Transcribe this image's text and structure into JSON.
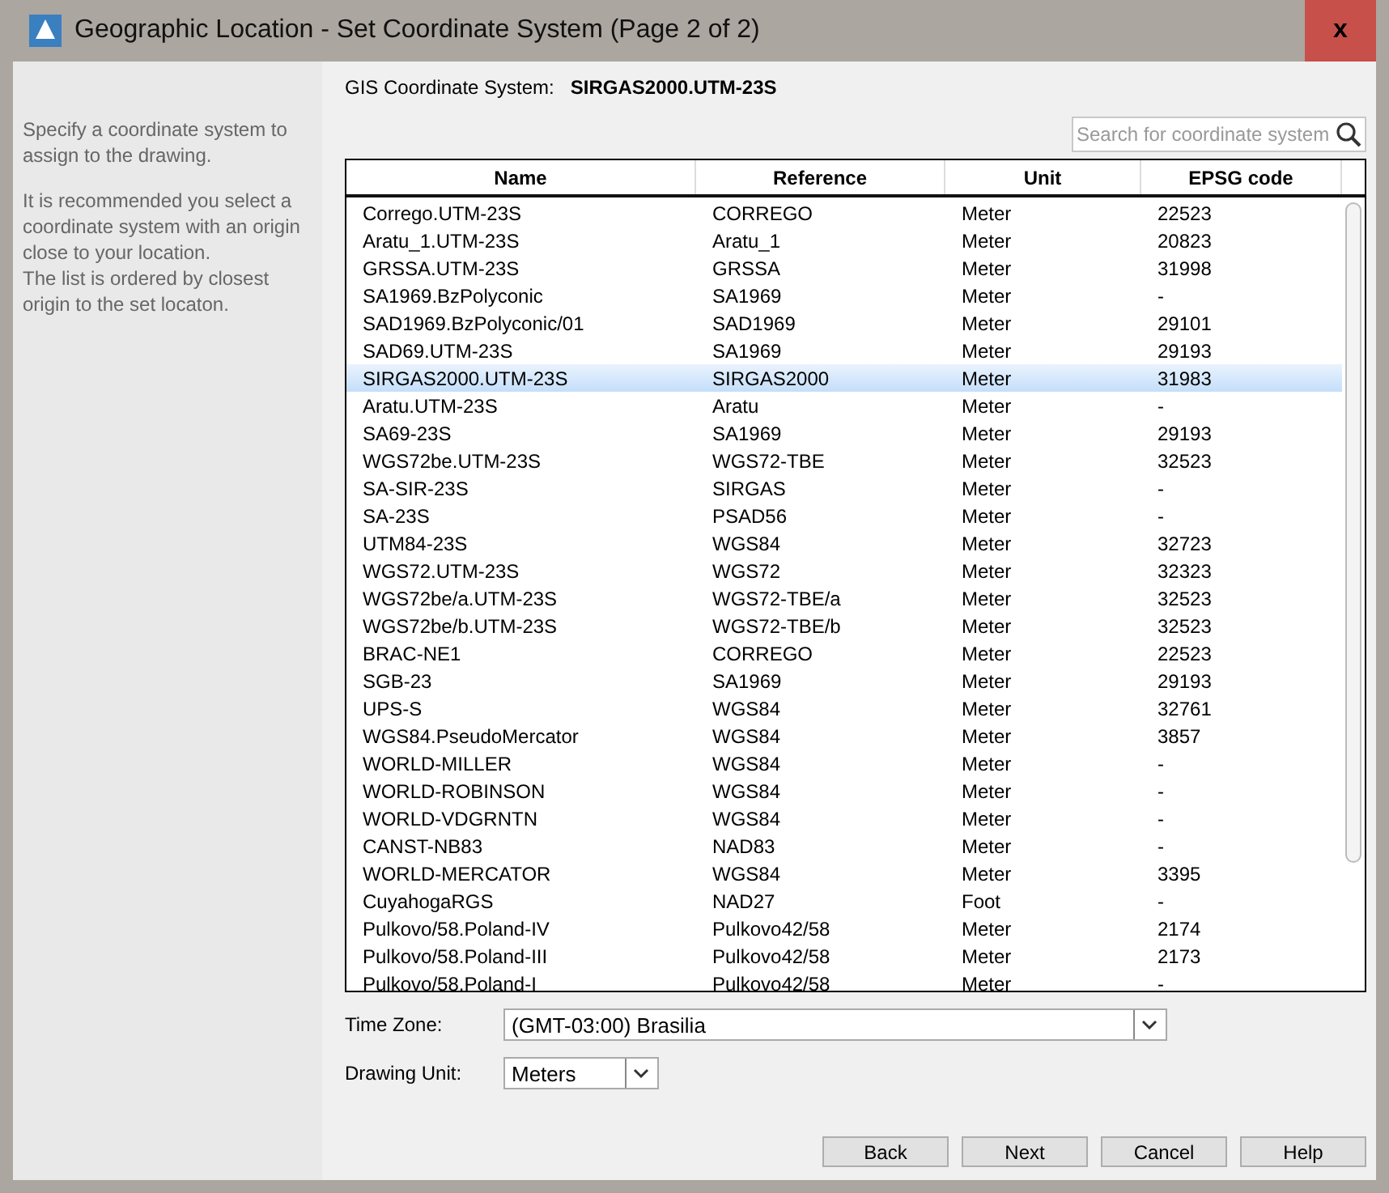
{
  "window": {
    "title": "Geographic Location - Set Coordinate System (Page 2 of 2)",
    "close": "x"
  },
  "sidebar": {
    "paragraphs": [
      "Specify a coordinate system to assign to the drawing.",
      "It is recommended you select a coordinate system with an origin close to your location.\nThe list is ordered by closest origin to the set locaton."
    ]
  },
  "gis": {
    "label": "GIS Coordinate System:",
    "value": "SIRGAS2000.UTM-23S"
  },
  "search": {
    "placeholder": "Search for coordinate system"
  },
  "table": {
    "columns": [
      "Name",
      "Reference",
      "Unit",
      "EPSG code"
    ],
    "rows": [
      {
        "cells": [
          "Corrego.UTM-23S",
          "CORREGO",
          "Meter",
          "22523"
        ],
        "selected": false
      },
      {
        "cells": [
          "Aratu_1.UTM-23S",
          "Aratu_1",
          "Meter",
          "20823"
        ],
        "selected": false
      },
      {
        "cells": [
          "GRSSA.UTM-23S",
          "GRSSA",
          "Meter",
          "31998"
        ],
        "selected": false
      },
      {
        "cells": [
          "SA1969.BzPolyconic",
          "SA1969",
          "Meter",
          "-"
        ],
        "selected": false
      },
      {
        "cells": [
          "SAD1969.BzPolyconic/01",
          "SAD1969",
          "Meter",
          "29101"
        ],
        "selected": false
      },
      {
        "cells": [
          "SAD69.UTM-23S",
          "SA1969",
          "Meter",
          "29193"
        ],
        "selected": false
      },
      {
        "cells": [
          "SIRGAS2000.UTM-23S",
          "SIRGAS2000",
          "Meter",
          "31983"
        ],
        "selected": true
      },
      {
        "cells": [
          "Aratu.UTM-23S",
          "Aratu",
          "Meter",
          "-"
        ],
        "selected": false
      },
      {
        "cells": [
          "SA69-23S",
          "SA1969",
          "Meter",
          "29193"
        ],
        "selected": false
      },
      {
        "cells": [
          "WGS72be.UTM-23S",
          "WGS72-TBE",
          "Meter",
          "32523"
        ],
        "selected": false
      },
      {
        "cells": [
          "SA-SIR-23S",
          "SIRGAS",
          "Meter",
          "-"
        ],
        "selected": false
      },
      {
        "cells": [
          "SA-23S",
          "PSAD56",
          "Meter",
          "-"
        ],
        "selected": false
      },
      {
        "cells": [
          "UTM84-23S",
          "WGS84",
          "Meter",
          "32723"
        ],
        "selected": false
      },
      {
        "cells": [
          "WGS72.UTM-23S",
          "WGS72",
          "Meter",
          "32323"
        ],
        "selected": false
      },
      {
        "cells": [
          "WGS72be/a.UTM-23S",
          "WGS72-TBE/a",
          "Meter",
          "32523"
        ],
        "selected": false
      },
      {
        "cells": [
          "WGS72be/b.UTM-23S",
          "WGS72-TBE/b",
          "Meter",
          "32523"
        ],
        "selected": false
      },
      {
        "cells": [
          "BRAC-NE1",
          "CORREGO",
          "Meter",
          "22523"
        ],
        "selected": false
      },
      {
        "cells": [
          "SGB-23",
          "SA1969",
          "Meter",
          "29193"
        ],
        "selected": false
      },
      {
        "cells": [
          "UPS-S",
          "WGS84",
          "Meter",
          "32761"
        ],
        "selected": false
      },
      {
        "cells": [
          "WGS84.PseudoMercator",
          "WGS84",
          "Meter",
          "3857"
        ],
        "selected": false
      },
      {
        "cells": [
          "WORLD-MILLER",
          "WGS84",
          "Meter",
          "-"
        ],
        "selected": false
      },
      {
        "cells": [
          "WORLD-ROBINSON",
          "WGS84",
          "Meter",
          "-"
        ],
        "selected": false
      },
      {
        "cells": [
          "WORLD-VDGRNTN",
          "WGS84",
          "Meter",
          "-"
        ],
        "selected": false
      },
      {
        "cells": [
          "CANST-NB83",
          "NAD83",
          "Meter",
          "-"
        ],
        "selected": false
      },
      {
        "cells": [
          "WORLD-MERCATOR",
          "WGS84",
          "Meter",
          "3395"
        ],
        "selected": false
      },
      {
        "cells": [
          "CuyahogaRGS",
          "NAD27",
          "Foot",
          "-"
        ],
        "selected": false
      },
      {
        "cells": [
          "Pulkovo/58.Poland-IV",
          "Pulkovo42/58",
          "Meter",
          "2174"
        ],
        "selected": false
      },
      {
        "cells": [
          "Pulkovo/58.Poland-III",
          "Pulkovo42/58",
          "Meter",
          "2173"
        ],
        "selected": false
      },
      {
        "cells": [
          "Pulkovo/58.Poland-I",
          "Pulkovo42/58",
          "Meter",
          "-"
        ],
        "selected": false
      }
    ]
  },
  "time_zone": {
    "label": "Time Zone:",
    "value": "(GMT-03:00) Brasilia"
  },
  "drawing_unit": {
    "label": "Drawing Unit:",
    "value": "Meters"
  },
  "buttons": [
    "Back",
    "Next",
    "Cancel",
    "Help"
  ]
}
